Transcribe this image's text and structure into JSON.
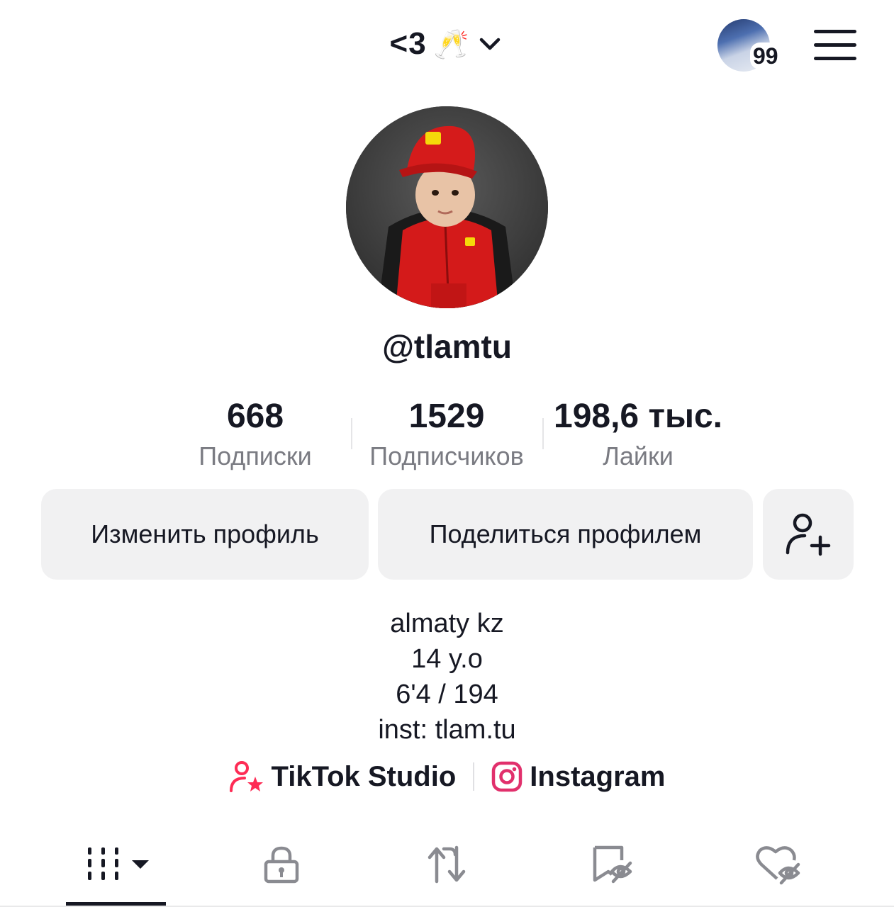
{
  "header": {
    "title": "<3",
    "title_emoji": "🥂",
    "story_count": "99"
  },
  "profile": {
    "username": "@tlamtu"
  },
  "stats": [
    {
      "value": "668",
      "label": "Подписки"
    },
    {
      "value": "1529",
      "label": "Подписчиков"
    },
    {
      "value": "198,6 тыс.",
      "label": "Лайки"
    }
  ],
  "actions": {
    "edit_label": "Изменить профиль",
    "share_label": "Поделиться профилем",
    "add_friend_icon": "add-user-icon"
  },
  "bio": {
    "lines": [
      "almaty kz",
      "14 y.o",
      "6'4 / 194",
      "inst: tlam.tu"
    ]
  },
  "links": {
    "studio_label": "TikTok Studio",
    "instagram_label": "Instagram"
  },
  "tabs": [
    {
      "icon": "videos-grid-icon",
      "active": true
    },
    {
      "icon": "lock-icon",
      "active": false
    },
    {
      "icon": "repost-icon",
      "active": false
    },
    {
      "icon": "bookmark-hidden-icon",
      "active": false
    },
    {
      "icon": "liked-hidden-icon",
      "active": false
    }
  ],
  "colors": {
    "text": "#161823",
    "muted": "#7a7b82",
    "button_bg": "#f1f1f2",
    "accent_pink": "#fe2c55"
  }
}
